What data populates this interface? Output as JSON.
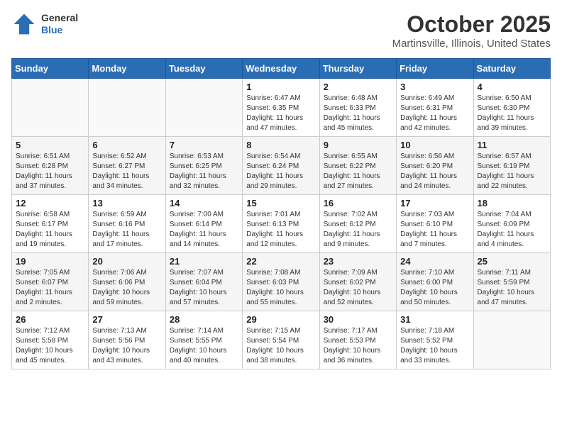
{
  "header": {
    "logo": {
      "general": "General",
      "blue": "Blue"
    },
    "title": "October 2025",
    "location": "Martinsville, Illinois, United States"
  },
  "weekdays": [
    "Sunday",
    "Monday",
    "Tuesday",
    "Wednesday",
    "Thursday",
    "Friday",
    "Saturday"
  ],
  "weeks": [
    [
      {
        "day": "",
        "info": ""
      },
      {
        "day": "",
        "info": ""
      },
      {
        "day": "",
        "info": ""
      },
      {
        "day": "1",
        "info": "Sunrise: 6:47 AM\nSunset: 6:35 PM\nDaylight: 11 hours\nand 47 minutes."
      },
      {
        "day": "2",
        "info": "Sunrise: 6:48 AM\nSunset: 6:33 PM\nDaylight: 11 hours\nand 45 minutes."
      },
      {
        "day": "3",
        "info": "Sunrise: 6:49 AM\nSunset: 6:31 PM\nDaylight: 11 hours\nand 42 minutes."
      },
      {
        "day": "4",
        "info": "Sunrise: 6:50 AM\nSunset: 6:30 PM\nDaylight: 11 hours\nand 39 minutes."
      }
    ],
    [
      {
        "day": "5",
        "info": "Sunrise: 6:51 AM\nSunset: 6:28 PM\nDaylight: 11 hours\nand 37 minutes."
      },
      {
        "day": "6",
        "info": "Sunrise: 6:52 AM\nSunset: 6:27 PM\nDaylight: 11 hours\nand 34 minutes."
      },
      {
        "day": "7",
        "info": "Sunrise: 6:53 AM\nSunset: 6:25 PM\nDaylight: 11 hours\nand 32 minutes."
      },
      {
        "day": "8",
        "info": "Sunrise: 6:54 AM\nSunset: 6:24 PM\nDaylight: 11 hours\nand 29 minutes."
      },
      {
        "day": "9",
        "info": "Sunrise: 6:55 AM\nSunset: 6:22 PM\nDaylight: 11 hours\nand 27 minutes."
      },
      {
        "day": "10",
        "info": "Sunrise: 6:56 AM\nSunset: 6:20 PM\nDaylight: 11 hours\nand 24 minutes."
      },
      {
        "day": "11",
        "info": "Sunrise: 6:57 AM\nSunset: 6:19 PM\nDaylight: 11 hours\nand 22 minutes."
      }
    ],
    [
      {
        "day": "12",
        "info": "Sunrise: 6:58 AM\nSunset: 6:17 PM\nDaylight: 11 hours\nand 19 minutes."
      },
      {
        "day": "13",
        "info": "Sunrise: 6:59 AM\nSunset: 6:16 PM\nDaylight: 11 hours\nand 17 minutes."
      },
      {
        "day": "14",
        "info": "Sunrise: 7:00 AM\nSunset: 6:14 PM\nDaylight: 11 hours\nand 14 minutes."
      },
      {
        "day": "15",
        "info": "Sunrise: 7:01 AM\nSunset: 6:13 PM\nDaylight: 11 hours\nand 12 minutes."
      },
      {
        "day": "16",
        "info": "Sunrise: 7:02 AM\nSunset: 6:12 PM\nDaylight: 11 hours\nand 9 minutes."
      },
      {
        "day": "17",
        "info": "Sunrise: 7:03 AM\nSunset: 6:10 PM\nDaylight: 11 hours\nand 7 minutes."
      },
      {
        "day": "18",
        "info": "Sunrise: 7:04 AM\nSunset: 6:09 PM\nDaylight: 11 hours\nand 4 minutes."
      }
    ],
    [
      {
        "day": "19",
        "info": "Sunrise: 7:05 AM\nSunset: 6:07 PM\nDaylight: 11 hours\nand 2 minutes."
      },
      {
        "day": "20",
        "info": "Sunrise: 7:06 AM\nSunset: 6:06 PM\nDaylight: 10 hours\nand 59 minutes."
      },
      {
        "day": "21",
        "info": "Sunrise: 7:07 AM\nSunset: 6:04 PM\nDaylight: 10 hours\nand 57 minutes."
      },
      {
        "day": "22",
        "info": "Sunrise: 7:08 AM\nSunset: 6:03 PM\nDaylight: 10 hours\nand 55 minutes."
      },
      {
        "day": "23",
        "info": "Sunrise: 7:09 AM\nSunset: 6:02 PM\nDaylight: 10 hours\nand 52 minutes."
      },
      {
        "day": "24",
        "info": "Sunrise: 7:10 AM\nSunset: 6:00 PM\nDaylight: 10 hours\nand 50 minutes."
      },
      {
        "day": "25",
        "info": "Sunrise: 7:11 AM\nSunset: 5:59 PM\nDaylight: 10 hours\nand 47 minutes."
      }
    ],
    [
      {
        "day": "26",
        "info": "Sunrise: 7:12 AM\nSunset: 5:58 PM\nDaylight: 10 hours\nand 45 minutes."
      },
      {
        "day": "27",
        "info": "Sunrise: 7:13 AM\nSunset: 5:56 PM\nDaylight: 10 hours\nand 43 minutes."
      },
      {
        "day": "28",
        "info": "Sunrise: 7:14 AM\nSunset: 5:55 PM\nDaylight: 10 hours\nand 40 minutes."
      },
      {
        "day": "29",
        "info": "Sunrise: 7:15 AM\nSunset: 5:54 PM\nDaylight: 10 hours\nand 38 minutes."
      },
      {
        "day": "30",
        "info": "Sunrise: 7:17 AM\nSunset: 5:53 PM\nDaylight: 10 hours\nand 36 minutes."
      },
      {
        "day": "31",
        "info": "Sunrise: 7:18 AM\nSunset: 5:52 PM\nDaylight: 10 hours\nand 33 minutes."
      },
      {
        "day": "",
        "info": ""
      }
    ]
  ]
}
